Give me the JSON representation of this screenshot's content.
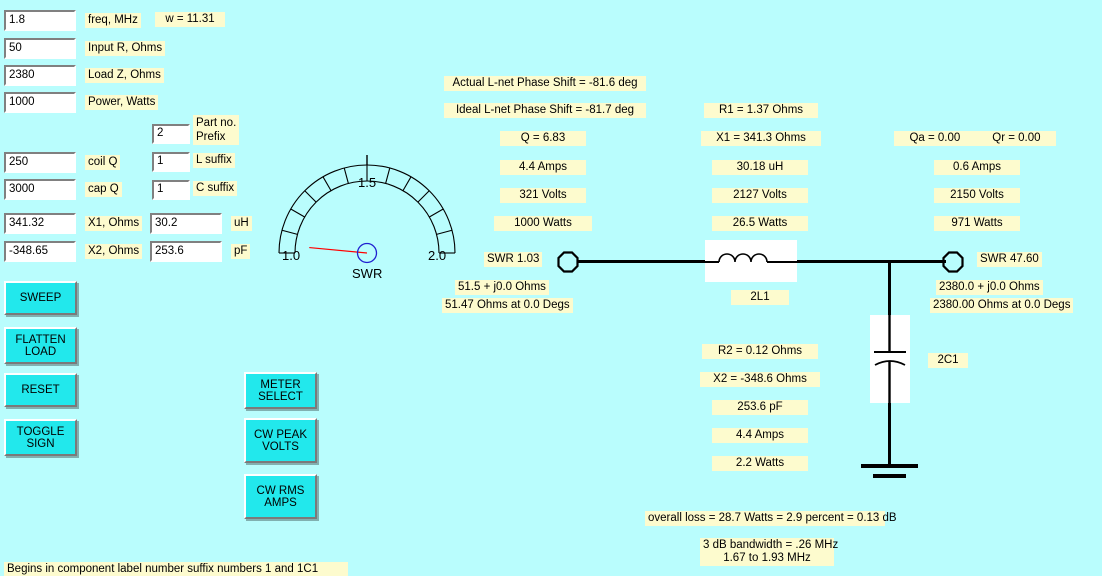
{
  "app": {
    "background_color": "#b9fdfd",
    "label_color": "#fdfbce",
    "button_color": "#22e8ec"
  },
  "inputs": [
    {
      "name": "freq",
      "value": "1.8",
      "label": "freq, MHz"
    },
    {
      "name": "input_r",
      "value": "50",
      "label": "Input R, Ohms"
    },
    {
      "name": "load_z",
      "value": "2380",
      "label": "Load Z, Ohms"
    },
    {
      "name": "power",
      "value": "1000",
      "label": "Power, Watts"
    },
    {
      "name": "part_prefix",
      "value": "2",
      "label": "Part no.\nPrefix"
    },
    {
      "name": "coil_q",
      "value": "250",
      "label": "coil Q"
    },
    {
      "name": "cap_q",
      "value": "3000",
      "label": "cap Q"
    },
    {
      "name": "l_suffix",
      "value": "1",
      "label": "L suffix"
    },
    {
      "name": "c_suffix",
      "value": "1",
      "label": "C suffix"
    },
    {
      "name": "x1_ohms",
      "value": "341.32",
      "label": "X1, Ohms"
    },
    {
      "name": "x2_ohms",
      "value": "-348.65",
      "label": "X2, Ohms"
    },
    {
      "name": "uh",
      "value": "30.2",
      "label": "uH"
    },
    {
      "name": "pf",
      "value": "253.6",
      "label": "pF"
    }
  ],
  "omega_label": "w = 11.31",
  "buttons": {
    "sweep": "SWEEP",
    "flatten_load": "FLATTEN\nLOAD",
    "reset": "RESET",
    "toggle_sign": "TOGGLE\nSIGN",
    "meter_select": "METER\nSELECT",
    "cw_peak_volts": "CW PEAK\nVOLTS",
    "cw_rms_amps": "CW RMS\nAMPS"
  },
  "gauge": {
    "caption": "SWR",
    "min_label": "1.0",
    "mid_label": "1.5",
    "max_label": "2.0",
    "min_value": 1.0,
    "max_value": 2.0,
    "value": 1.03,
    "needle_color": "#ff0000",
    "hub_color": "#2020d0",
    "segments": 12
  },
  "phase": {
    "actual": "Actual L-net Phase Shift = -81.6 deg",
    "ideal": "Ideal L-net Phase Shift = -81.7 deg"
  },
  "center_stack": {
    "q": "Q = 6.83",
    "amps": "4.4 Amps",
    "volts": "321 Volts",
    "watts": "1000 Watts"
  },
  "series_branch": {
    "r": "R1 = 1.37 Ohms",
    "x": "X1 = 341.3 Ohms",
    "inductance": "30.18 uH",
    "volts": "2127 Volts",
    "watts": "26.5 Watts",
    "part_label": "2L1"
  },
  "shunt_branch": {
    "r": "R2 = 0.12 Ohms",
    "x": "X2 = -348.6 Ohms",
    "capacitance": "253.6 pF",
    "amps": "4.4 Amps",
    "watts": "2.2 Watts",
    "part_label": "2C1"
  },
  "load_stack": {
    "qaqr": "Qa = 0.00          Qr = 0.00",
    "amps": "0.6 Amps",
    "volts": "2150 Volts",
    "watts": "971 Watts"
  },
  "input_port": {
    "swr": "SWR 1.03",
    "complex": "51.5 + j0.0 Ohms",
    "polar": "51.47 Ohms at 0.0 Degs"
  },
  "output_port": {
    "swr": "SWR 47.60",
    "complex": "2380.0 + j0.0 Ohms",
    "polar": "2380.00 Ohms at 0.0 Degs"
  },
  "summary": {
    "loss": "overall loss = 28.7 Watts = 2.9 percent = 0.13 dB",
    "bandwidth_line1": "3 dB bandwidth = .26 MHz",
    "bandwidth_line2": "1.67 to 1.93 MHz"
  },
  "status_bar": {
    "text": "Begins in component label number suffix numbers 1 and 1C1"
  }
}
